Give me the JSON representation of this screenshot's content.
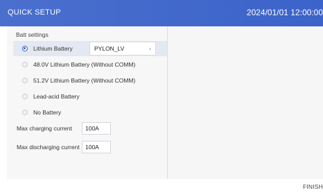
{
  "header": {
    "title": "QUICK SETUP",
    "datetime": "2024/01/01 12:00:00"
  },
  "batt": {
    "section_title": "Batt settings",
    "options": [
      {
        "label": "Lithium Battery",
        "selected": true
      },
      {
        "label": "48.0V Lithium Battery (Without COMM)",
        "selected": false
      },
      {
        "label": "51.2V Lithium Battery (Without COMM)",
        "selected": false
      },
      {
        "label": "Lead-acid Battery",
        "selected": false
      },
      {
        "label": "No Battery",
        "selected": false
      }
    ],
    "protocol_value": "PYLON_LV",
    "max_charging_label": "Max charging current",
    "max_charging_value": "100A",
    "max_discharging_label": "Max discharging current",
    "max_discharging_value": "100A"
  },
  "footer": {
    "finish_label": "FINISH"
  },
  "colors": {
    "header": "#3b63c9",
    "selected_row": "#e4e8f2"
  },
  "icons": {
    "chevron": "chevron-right-icon"
  }
}
